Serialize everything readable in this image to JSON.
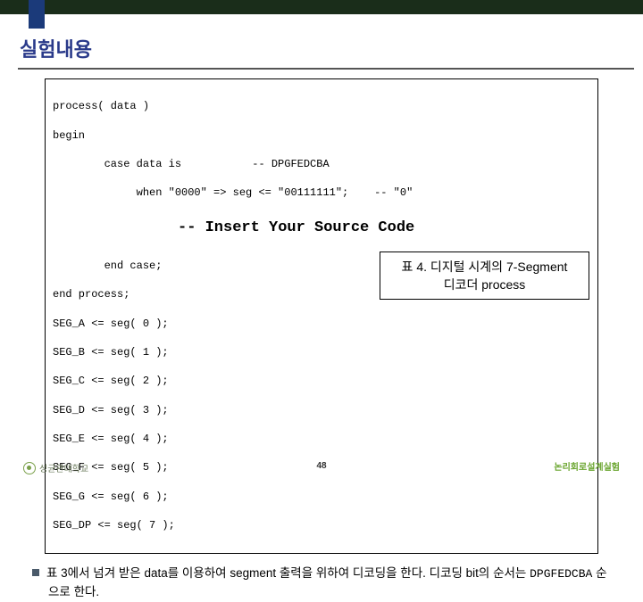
{
  "title": "실험내용",
  "code": {
    "line1": "process( data )",
    "line2": "begin",
    "line3a": "        case data is",
    "line3b": "-- DPGFEDCBA",
    "line4a": "             when \"0000\" => seg <= \"00111111\";",
    "line4b": "-- \"0\"",
    "insert": "-- Insert Your Source Code",
    "line5": "        end case;",
    "line6": "end process;",
    "line7": "SEG_A <= seg( 0 );",
    "line8": "SEG_B <= seg( 1 );",
    "line9": "SEG_C <= seg( 2 );",
    "line10": "SEG_D <= seg( 3 );",
    "line11": "SEG_E <= seg( 4 );",
    "line12": "SEG_F <= seg( 5 );",
    "line13": "SEG_G <= seg( 6 );",
    "line14": "SEG_DP <= seg( 7 );"
  },
  "caption": {
    "line1": "표 4. 디지털 시계의 7-Segment",
    "line2": "디코더 process"
  },
  "bullet": {
    "pre": "표 3에서 넘겨 받은 data를 이용하여 segment 출력을 위하여 디코딩을 한다. 디코딩 bit의 순서는 ",
    "mono": "DPGFEDCBA",
    "post": " 순으로 한다."
  },
  "footer": {
    "left": "성균관대학교",
    "center": "48",
    "right": "논리회로설계실험"
  }
}
